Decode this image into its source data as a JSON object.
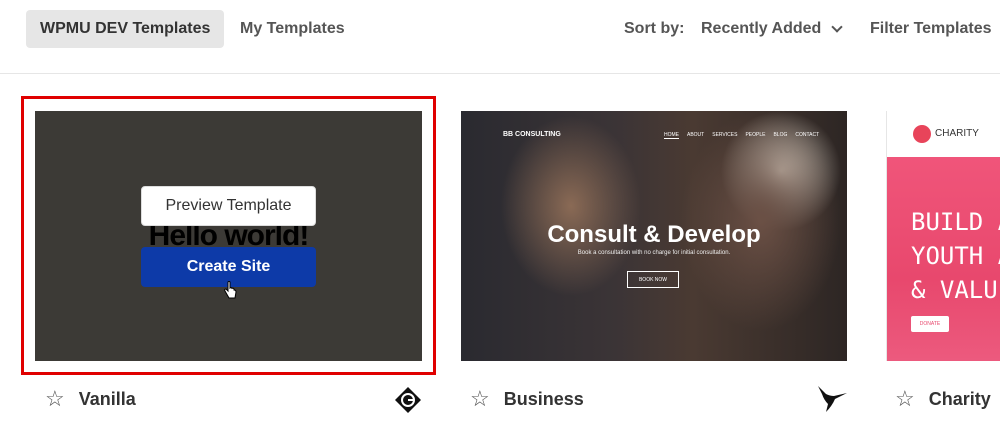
{
  "tabs": [
    {
      "label": "WPMU DEV Templates",
      "active": true
    },
    {
      "label": "My Templates",
      "active": false
    }
  ],
  "sort": {
    "label": "Sort by:",
    "value": "Recently Added"
  },
  "filter_label": "Filter Templates",
  "cards": [
    {
      "name": "Vanilla",
      "thumb_text": "Hello world!",
      "preview_label": "Preview Template",
      "create_label": "Create Site",
      "author_icon": "g-diamond-icon"
    },
    {
      "name": "Business",
      "brand": "BB CONSULTING",
      "nav": [
        "HOME",
        "ABOUT",
        "SERVICES",
        "PEOPLE",
        "BLOG",
        "CONTACT"
      ],
      "hero_title": "Consult & Develop",
      "hero_sub": "Book a consultation with no charge for initial consultation.",
      "hero_button": "BOOK NOW",
      "author_icon": "hummingbird-icon"
    },
    {
      "name": "Charity",
      "brand": "CHARITY",
      "hero_lines": [
        "BUILD A WO",
        "YOUTH ARE",
        "& VALUED"
      ],
      "hero_button": "DONATE"
    }
  ],
  "colors": {
    "highlight": "#e00000",
    "create_button": "#0d3aa8",
    "tab_active_bg": "#e6e6e6"
  }
}
